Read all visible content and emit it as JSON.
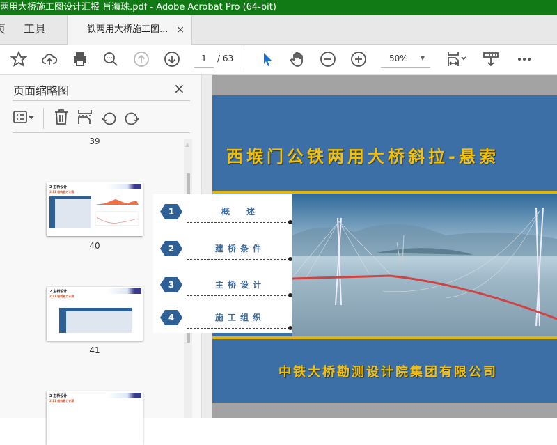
{
  "window": {
    "title": "两用大桥施工图设计汇报 肖海珠.pdf - Adobe Acrobat Pro (64-bit)"
  },
  "tabs": {
    "home_partial": "页",
    "tools": "工具",
    "document": "铁两用大桥施工图...",
    "close": "×"
  },
  "toolbar": {
    "page_current": "1",
    "page_total": "/ 63",
    "zoom": "50%"
  },
  "sidebar": {
    "title": "页面缩略图",
    "close": "×",
    "thumbnails": [
      {
        "page": "39"
      },
      {
        "page": "40",
        "heading": "2 主桥设计",
        "subheading": "2.11 结构静力计算"
      },
      {
        "page": "41",
        "heading": "2 主桥设计",
        "subheading": "2.11 结构静力计算"
      },
      {
        "heading": "2 主桥设计",
        "subheading": "2.11 结构静力计算"
      }
    ]
  },
  "slide": {
    "title": "西堠门公铁两用大桥斜拉-悬索",
    "company": "中铁大桥勘测设计院集团有限公司",
    "menu": [
      {
        "num": "1",
        "label": "概　述"
      },
      {
        "num": "2",
        "label": "建桥条件"
      },
      {
        "num": "3",
        "label": "主桥设计"
      },
      {
        "num": "4",
        "label": "施工组织"
      }
    ]
  },
  "colors": {
    "titlebar": "#117a14",
    "slide_blue": "#3c6fa6",
    "slide_gold": "#f5c000"
  }
}
